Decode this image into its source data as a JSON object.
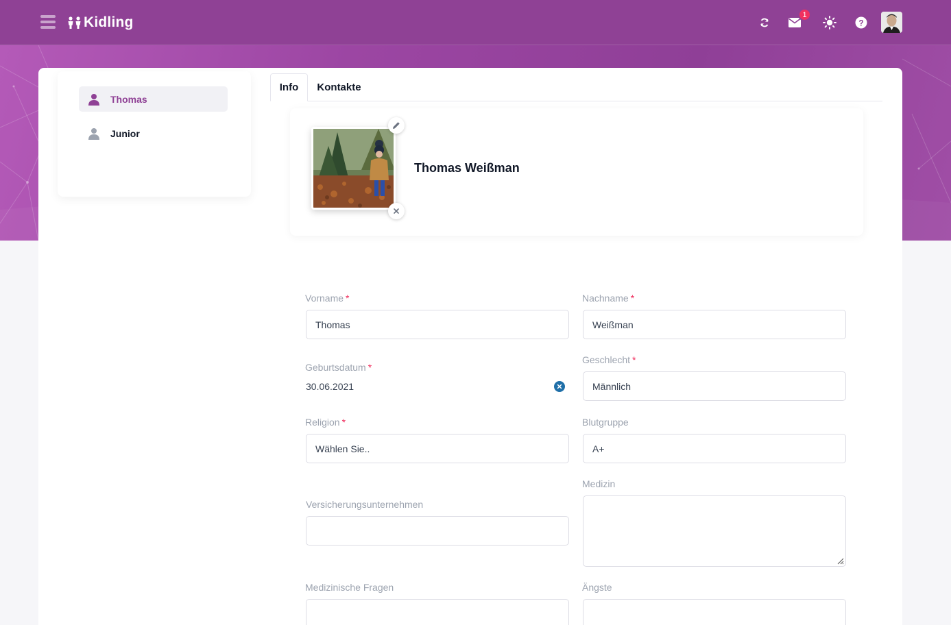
{
  "app": {
    "name": "Kidling"
  },
  "header": {
    "notification_count": "1"
  },
  "sidebar": {
    "children": [
      {
        "name": "Thomas",
        "active": true
      },
      {
        "name": "Junior",
        "active": false
      }
    ]
  },
  "tabs": [
    {
      "label": "Info"
    },
    {
      "label": "Kontakte"
    }
  ],
  "profile": {
    "full_name": "Thomas Weißman"
  },
  "form": {
    "vorname": {
      "label": "Vorname",
      "required": "*",
      "value": "Thomas"
    },
    "nachname": {
      "label": "Nachname",
      "required": "*",
      "value": "Weißman"
    },
    "geburtsdatum": {
      "label": "Geburtsdatum",
      "required": "*",
      "value": "30.06.2021"
    },
    "geschlecht": {
      "label": "Geschlecht",
      "required": "*",
      "value": "Männlich"
    },
    "religion": {
      "label": "Religion",
      "required": "*",
      "value": "Wählen Sie.."
    },
    "blutgruppe": {
      "label": "Blutgruppe",
      "value": "A+"
    },
    "medizin": {
      "label": "Medizin",
      "value": ""
    },
    "versicherung": {
      "label": "Versicherungsunternehmen",
      "value": ""
    },
    "medizinische_fragen": {
      "label": "Medizinische Fragen",
      "value": ""
    },
    "aengste": {
      "label": "Ängste",
      "value": ""
    }
  },
  "colors": {
    "brand": "#8f4195",
    "badge": "#f0315f",
    "required": "#ef2a5a",
    "date_clear": "#1f6fa8"
  }
}
